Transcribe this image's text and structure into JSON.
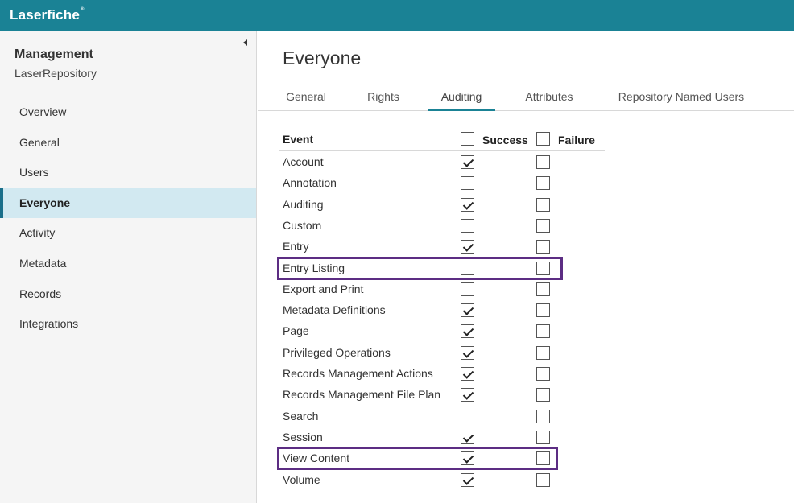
{
  "app": {
    "logo": "Laserfiche",
    "logo_mark": "®"
  },
  "sidebar": {
    "title": "Management",
    "subtitle": "LaserRepository",
    "items": [
      {
        "label": "Overview"
      },
      {
        "label": "General"
      },
      {
        "label": "Users"
      },
      {
        "label": "Everyone",
        "active": true
      },
      {
        "label": "Activity"
      },
      {
        "label": "Metadata"
      },
      {
        "label": "Records"
      },
      {
        "label": "Integrations"
      }
    ]
  },
  "page": {
    "title": "Everyone"
  },
  "tabs": [
    {
      "label": "General"
    },
    {
      "label": "Rights"
    },
    {
      "label": "Auditing",
      "active": true
    },
    {
      "label": "Attributes"
    },
    {
      "label": "Repository Named Users"
    }
  ],
  "table": {
    "headers": {
      "event": "Event",
      "success": "Success",
      "failure": "Failure"
    },
    "header_success_checked": false,
    "header_failure_checked": false,
    "rows": [
      {
        "event": "Account",
        "success": true,
        "failure": false
      },
      {
        "event": "Annotation",
        "success": false,
        "failure": false
      },
      {
        "event": "Auditing",
        "success": true,
        "failure": false
      },
      {
        "event": "Custom",
        "success": false,
        "failure": false
      },
      {
        "event": "Entry",
        "success": true,
        "failure": false
      },
      {
        "event": "Entry Listing",
        "success": false,
        "failure": false,
        "highlighted": true
      },
      {
        "event": "Export and Print",
        "success": false,
        "failure": false
      },
      {
        "event": "Metadata Definitions",
        "success": true,
        "failure": false
      },
      {
        "event": "Page",
        "success": true,
        "failure": false
      },
      {
        "event": "Privileged Operations",
        "success": true,
        "failure": false
      },
      {
        "event": "Records Management Actions",
        "success": true,
        "failure": false
      },
      {
        "event": "Records Management File Plan",
        "success": true,
        "failure": false
      },
      {
        "event": "Search",
        "success": false,
        "failure": false
      },
      {
        "event": "Session",
        "success": true,
        "failure": false
      },
      {
        "event": "View Content",
        "success": true,
        "failure": false,
        "highlighted": true
      },
      {
        "event": "Volume",
        "success": true,
        "failure": false
      }
    ]
  },
  "colors": {
    "topbar": "#1a8295",
    "highlight": "#5c2d83",
    "active_nav": "#d2e9f1"
  }
}
